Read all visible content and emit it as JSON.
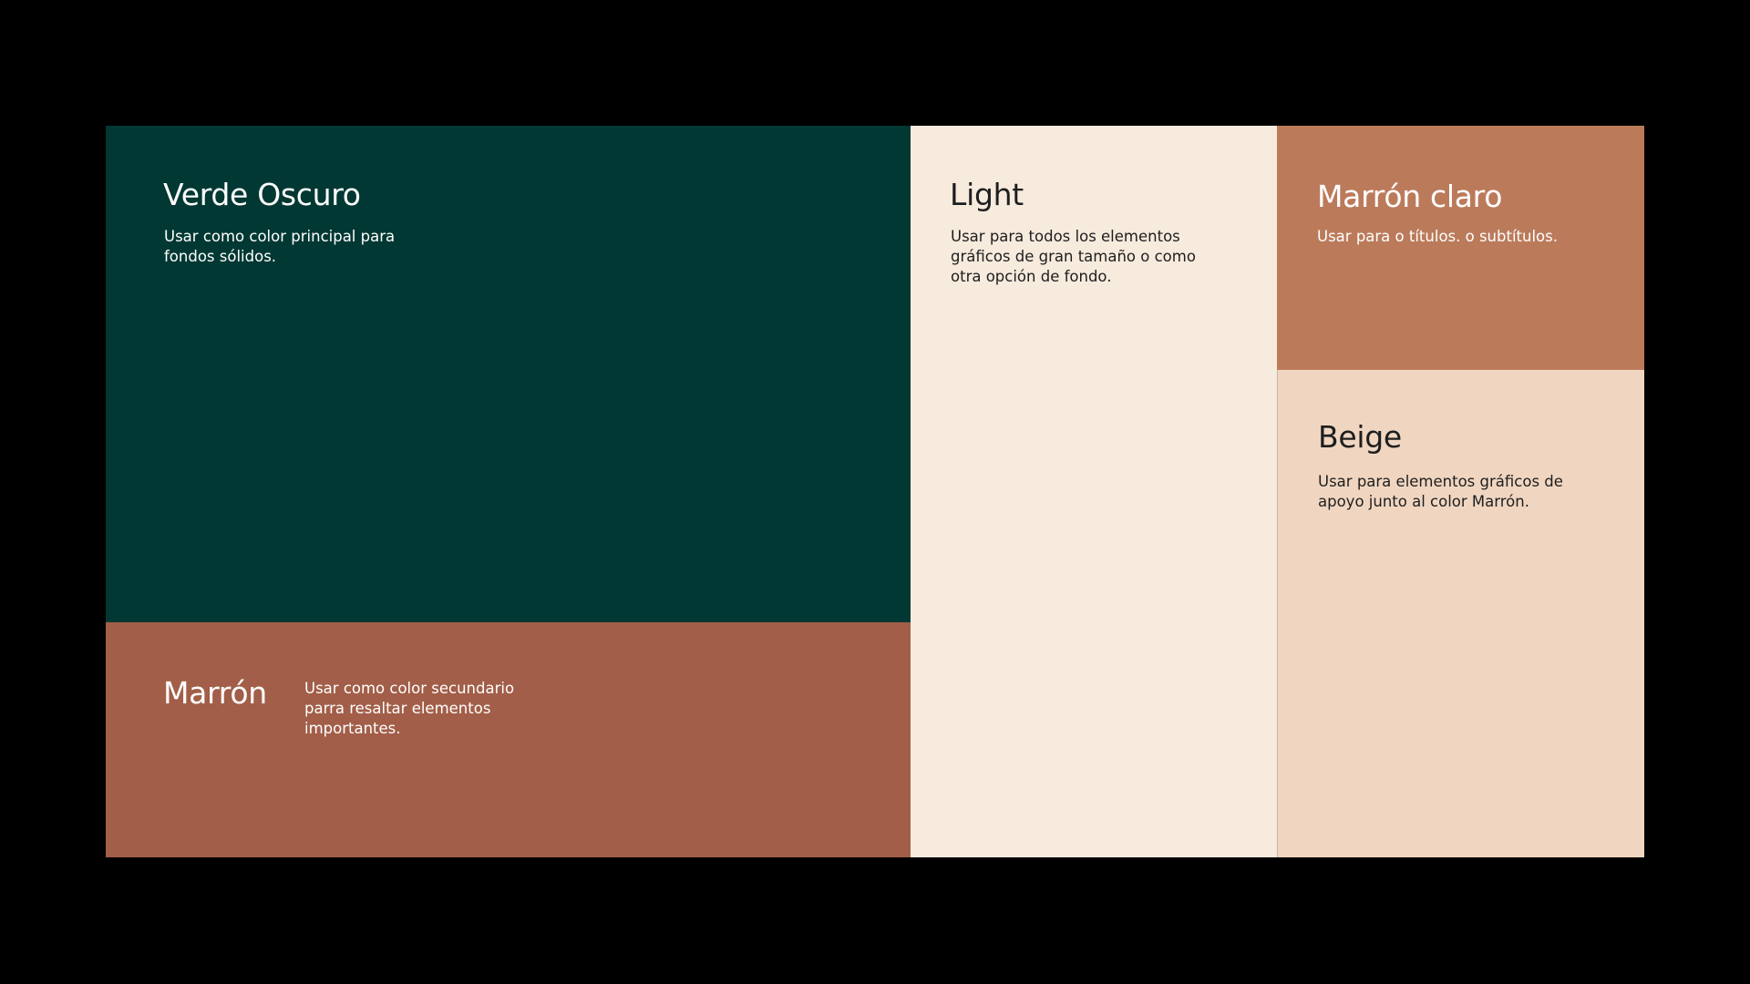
{
  "colors": {
    "page_background": "#000000",
    "divider": "#c9b3a4"
  },
  "swatches": {
    "verde_oscuro": {
      "name": "Verde Oscuro",
      "description": "Usar como color principal para fondos sólidos.",
      "color": "#023833",
      "text_color": "#ffffff"
    },
    "marron": {
      "name": "Marrón",
      "description": "Usar como color secundario parra resaltar elementos importantes.",
      "color": "#a25e48",
      "text_color": "#ffffff"
    },
    "light": {
      "name": "Light",
      "description": "Usar para todos los elementos gráficos de gran tamaño o como otra opción de fondo.",
      "color": "#f7ebde",
      "text_color": "#1e1e1e"
    },
    "marron_claro": {
      "name": "Marrón claro",
      "description": "Usar para o títulos. o subtítulos.",
      "color": "#bb7b5b",
      "text_color": "#ffffff"
    },
    "beige": {
      "name": "Beige",
      "description": "Usar para elementos gráficos de apoyo junto al color Marrón.",
      "color": "#f0d6c1",
      "text_color": "#1e1e1e"
    }
  }
}
